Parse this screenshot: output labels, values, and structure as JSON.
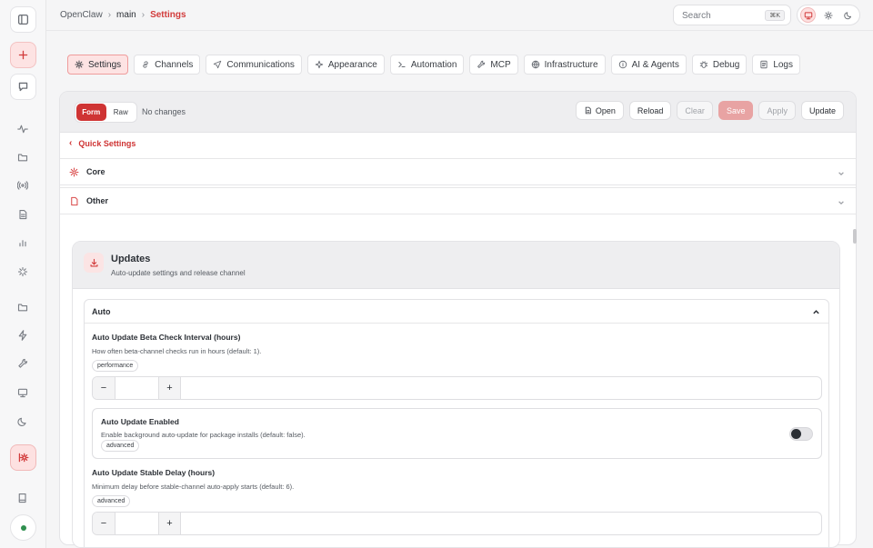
{
  "breadcrumb": {
    "root": "OpenClaw",
    "branch": "main",
    "current": "Settings"
  },
  "search": {
    "placeholder": "Search",
    "shortcut": "⌘K"
  },
  "tabs": [
    {
      "label": "Settings",
      "icon": "gear-icon",
      "active": true
    },
    {
      "label": "Channels",
      "icon": "link-icon"
    },
    {
      "label": "Communications",
      "icon": "send-icon"
    },
    {
      "label": "Appearance",
      "icon": "sparkle-icon"
    },
    {
      "label": "Automation",
      "icon": "terminal-icon"
    },
    {
      "label": "MCP",
      "icon": "wrench-icon"
    },
    {
      "label": "Infrastructure",
      "icon": "globe-icon"
    },
    {
      "label": "AI & Agents",
      "icon": "info-icon"
    },
    {
      "label": "Debug",
      "icon": "bug-icon"
    },
    {
      "label": "Logs",
      "icon": "list-icon"
    }
  ],
  "editor": {
    "mode_form": "Form",
    "mode_raw": "Raw",
    "status": "No changes",
    "actions": {
      "open": "Open",
      "reload": "Reload",
      "clear": "Clear",
      "save": "Save",
      "apply": "Apply",
      "update": "Update"
    }
  },
  "quick_settings": "Quick Settings",
  "sections": [
    {
      "label": "Core",
      "icon": "gear-icon"
    },
    {
      "label": "Other",
      "icon": "file-icon"
    }
  ],
  "updates": {
    "title": "Updates",
    "subtitle": "Auto-update settings and release channel",
    "group": "Auto",
    "fields": {
      "beta_interval": {
        "title": "Auto Update Beta Check Interval (hours)",
        "desc": "How often beta-channel checks run in hours (default: 1).",
        "tag": "performance",
        "value": ""
      },
      "enabled": {
        "title": "Auto Update Enabled",
        "desc": "Enable background auto-update for package installs (default: false).",
        "tag": "advanced",
        "on": false
      },
      "stable_delay": {
        "title": "Auto Update Stable Delay (hours)",
        "desc": "Minimum delay before stable-channel auto-apply starts (default: 6).",
        "tag": "advanced",
        "value": ""
      }
    },
    "stepper": {
      "minus": "−",
      "plus": "+"
    }
  },
  "colors": {
    "accent": "#cf3434",
    "accent_soft": "#fde3e3"
  }
}
